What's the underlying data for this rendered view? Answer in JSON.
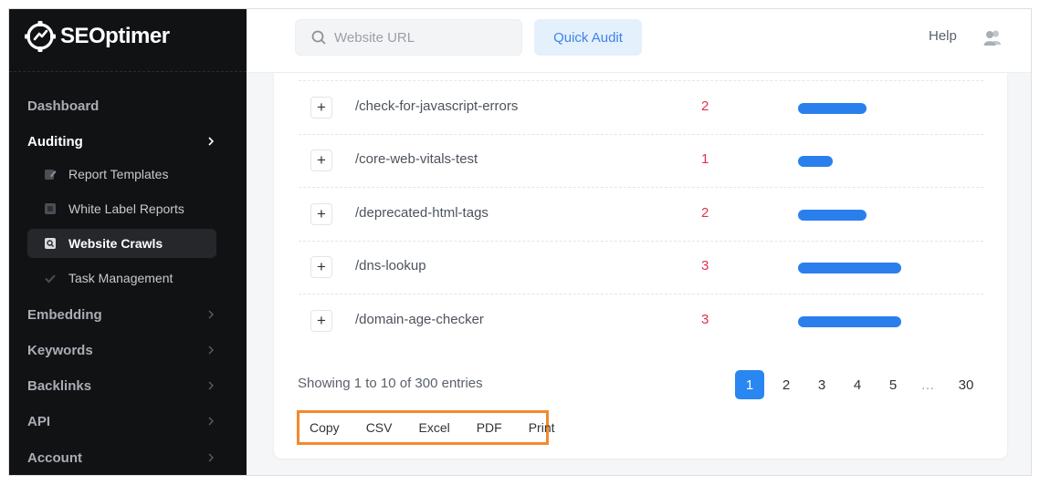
{
  "brand": {
    "name": "SEOptimer"
  },
  "sidebar": {
    "items": [
      {
        "label": "Dashboard"
      },
      {
        "label": "Auditing"
      },
      {
        "label": "Embedding"
      },
      {
        "label": "Keywords"
      },
      {
        "label": "Backlinks"
      },
      {
        "label": "API"
      },
      {
        "label": "Account"
      }
    ],
    "auditing_sub": [
      {
        "label": "Report Templates",
        "icon": "edit-icon"
      },
      {
        "label": "White Label Reports",
        "icon": "document-icon"
      },
      {
        "label": "Website Crawls",
        "icon": "crawl-search-icon"
      },
      {
        "label": "Task Management",
        "icon": "check-icon"
      }
    ]
  },
  "topbar": {
    "search_placeholder": "Website URL",
    "quick_audit": "Quick Audit",
    "help": "Help"
  },
  "table": {
    "rows": [
      {
        "path": "/check-for-javascript-errors",
        "count": "2",
        "bar_level": 2
      },
      {
        "path": "/core-web-vitals-test",
        "count": "1",
        "bar_level": 1
      },
      {
        "path": "/deprecated-html-tags",
        "count": "2",
        "bar_level": 2
      },
      {
        "path": "/dns-lookup",
        "count": "3",
        "bar_level": 3
      },
      {
        "path": "/domain-age-checker",
        "count": "3",
        "bar_level": 3
      }
    ],
    "expand_symbol": "+"
  },
  "footer": {
    "showing": "Showing 1 to 10 of 300 entries",
    "pages": [
      "1",
      "2",
      "3",
      "4",
      "5",
      "…",
      "30"
    ],
    "current_page": "1"
  },
  "export": {
    "buttons": [
      "Copy",
      "CSV",
      "Excel",
      "PDF",
      "Print"
    ]
  },
  "colors": {
    "sidebar_bg": "#111214",
    "accent_blue": "#2a7fed",
    "count_red": "#e0314e",
    "export_highlight": "#f28a2b"
  }
}
